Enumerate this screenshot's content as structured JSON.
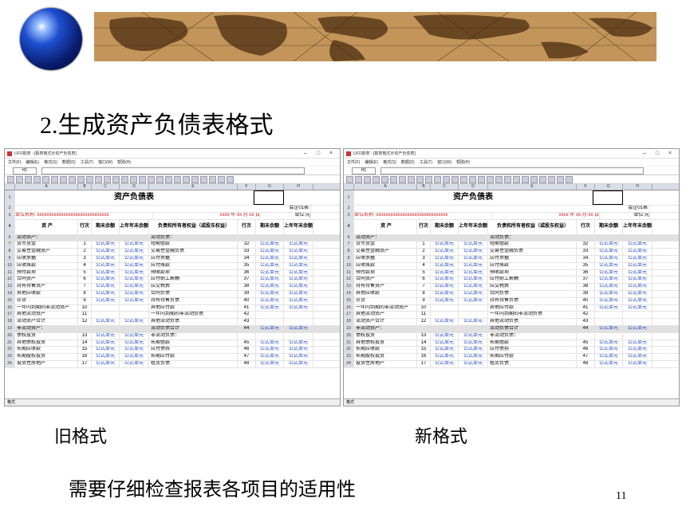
{
  "slide": {
    "title": "2.生成资产负债表格式",
    "caption_left": "旧格式",
    "caption_right": "新格式",
    "note": "需要仔细检查报表各项目的适用性",
    "page_number": "11"
  },
  "window": {
    "app_title": "UFO报表 - [报表格式示资产负债表]",
    "controls": [
      "–",
      "□",
      "×"
    ],
    "menus": [
      "文件(F)",
      "编辑(E)",
      "格式(S)",
      "数据(D)",
      "工具(T)",
      "窗口(W)",
      "帮助(H)"
    ],
    "cell_ref": "H1",
    "columns": [
      "A",
      "B",
      "C",
      "D",
      "E",
      "F",
      "G",
      "H"
    ],
    "status": "格式"
  },
  "sheet": {
    "title": "资产负债表",
    "unit_code": "会企01表",
    "unit_label": "单位:元",
    "company_label": "单位名称: xxxxxxxxxxxxxxxxxxxxxxxxxxxxxx",
    "date_label": "xxxx 年 xx 月 xx 日",
    "headers": {
      "asset": "资    产",
      "row_no": "行次",
      "end_balance": "期末余额",
      "prior_year": "上年年末余额",
      "liab": "负债和所有者权益（或股东权益）",
      "row_no2": "行次",
      "end_balance2": "期末余额",
      "prior_year2": "上年年末余额"
    },
    "formula": "公式单元",
    "rows": [
      {
        "n": "6",
        "a": "流动资产：",
        "b": "",
        "c": "",
        "d": "",
        "e": "流动负债：",
        "f": "",
        "g": "",
        "h": "",
        "sect": true
      },
      {
        "n": "7",
        "a": "货币资金",
        "b": "1",
        "c": "公式单元",
        "d": "公式单元",
        "e": "短期借款",
        "f": "32",
        "g": "公式单元",
        "h": "公式单元"
      },
      {
        "n": "8",
        "a": "交易性金融资产",
        "b": "2",
        "c": "公式单元",
        "d": "公式单元",
        "e": "交易性金融负债",
        "f": "33",
        "g": "公式单元",
        "h": "公式单元"
      },
      {
        "n": "9",
        "a": "应收票据",
        "b": "3",
        "c": "公式单元",
        "d": "公式单元",
        "e": "应付票据",
        "f": "34",
        "g": "公式单元",
        "h": "公式单元"
      },
      {
        "n": "10",
        "a": "应收账款",
        "b": "4",
        "c": "公式单元",
        "d": "公式单元",
        "e": "应付账款",
        "f": "35",
        "g": "公式单元",
        "h": "公式单元"
      },
      {
        "n": "11",
        "a": "预付款项",
        "b": "5",
        "c": "公式单元",
        "d": "公式单元",
        "e": "预收款项",
        "f": "36",
        "g": "公式单元",
        "h": "公式单元"
      },
      {
        "n": "12",
        "a": "合同资产",
        "b": "6",
        "c": "公式单元",
        "d": "公式单元",
        "e": "应付职工薪酬",
        "f": "37",
        "g": "公式单元",
        "h": "公式单元"
      },
      {
        "n": "13",
        "a": "持有待售资产",
        "b": "7",
        "c": "公式单元",
        "d": "公式单元",
        "e": "应交税费",
        "f": "38",
        "g": "公式单元",
        "h": "公式单元"
      },
      {
        "n": "14",
        "a": "其他应收款",
        "b": "8",
        "c": "公式单元",
        "d": "公式单元",
        "e": "合同负债",
        "f": "39",
        "g": "公式单元",
        "h": "公式单元"
      },
      {
        "n": "15",
        "a": "存货",
        "b": "9",
        "c": "公式单元",
        "d": "公式单元",
        "e": "持有待售负债",
        "f": "40",
        "g": "公式单元",
        "h": "公式单元"
      },
      {
        "n": "16",
        "a": "一年内到期的非流动资产",
        "b": "10",
        "c": "",
        "d": "",
        "e": "其他应付款",
        "f": "41",
        "g": "公式单元",
        "h": "公式单元"
      },
      {
        "n": "17",
        "a": "其他流动资产",
        "b": "11",
        "c": "",
        "d": "",
        "e": "一年内到期的非流动负债",
        "f": "42",
        "g": "",
        "h": ""
      },
      {
        "n": "18",
        "a": "流动资产合计",
        "b": "12",
        "c": "公式单元",
        "d": "公式单元",
        "e": "其他流动负债",
        "f": "43",
        "g": "",
        "h": ""
      },
      {
        "n": "19",
        "a": "非流动资产：",
        "b": "",
        "c": "",
        "d": "",
        "e": "流动负债合计",
        "f": "44",
        "g": "公式单元",
        "h": "公式单元",
        "sect": true
      },
      {
        "n": "20",
        "a": "债权投资",
        "b": "13",
        "c": "公式单元",
        "d": "公式单元",
        "e": "非流动负债：",
        "f": "",
        "g": "",
        "h": ""
      },
      {
        "n": "21",
        "a": "其他债权投资",
        "b": "14",
        "c": "公式单元",
        "d": "公式单元",
        "e": "长期借款",
        "f": "45",
        "g": "公式单元",
        "h": "公式单元"
      },
      {
        "n": "22",
        "a": "长期应收款",
        "b": "15",
        "c": "公式单元",
        "d": "公式单元",
        "e": "应付债券",
        "f": "46",
        "g": "公式单元",
        "h": "公式单元"
      },
      {
        "n": "23",
        "a": "长期股权投资",
        "b": "16",
        "c": "公式单元",
        "d": "公式单元",
        "e": "长期应付款",
        "f": "47",
        "g": "公式单元",
        "h": "公式单元"
      },
      {
        "n": "24",
        "a": "投资性房地产",
        "b": "17",
        "c": "公式单元",
        "d": "公式单元",
        "e": "租赁负债",
        "f": "48",
        "g": "公式单元",
        "h": "公式单元"
      }
    ]
  }
}
